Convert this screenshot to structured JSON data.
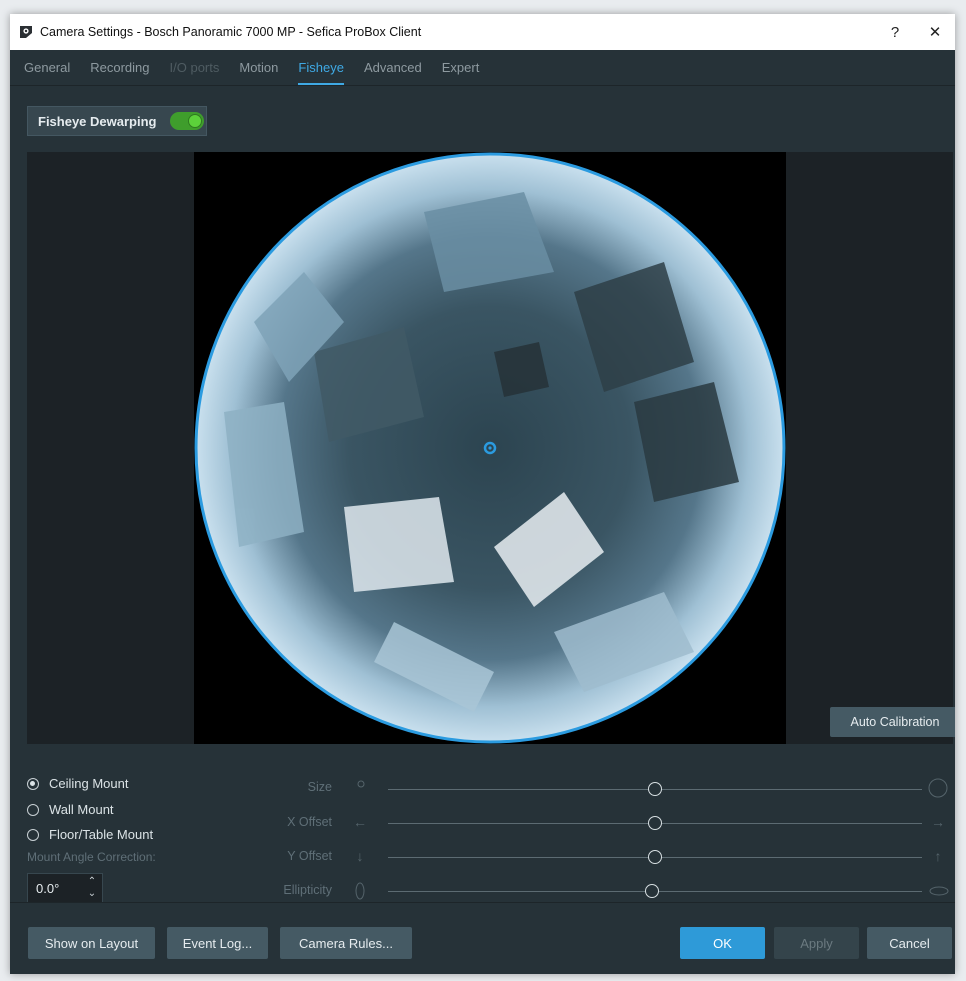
{
  "window": {
    "title": "Camera Settings - Bosch Panoramic 7000 MP - Sefica ProBox Client",
    "help_label": "?",
    "close_label": "✕"
  },
  "tabs": [
    {
      "label": "General",
      "state": "normal"
    },
    {
      "label": "Recording",
      "state": "normal"
    },
    {
      "label": "I/O ports",
      "state": "disabled"
    },
    {
      "label": "Motion",
      "state": "normal"
    },
    {
      "label": "Fisheye",
      "state": "active"
    },
    {
      "label": "Advanced",
      "state": "normal"
    },
    {
      "label": "Expert",
      "state": "normal"
    }
  ],
  "fisheye": {
    "dewarping_label": "Fisheye Dewarping",
    "dewarping_enabled": true,
    "auto_calibration_label": "Auto Calibration"
  },
  "mount": {
    "options": [
      {
        "label": "Ceiling Mount",
        "checked": true
      },
      {
        "label": "Wall Mount",
        "checked": false
      },
      {
        "label": "Floor/Table Mount",
        "checked": false
      }
    ],
    "angle_label": "Mount Angle Correction:",
    "angle_value": "0.0°"
  },
  "sliders": [
    {
      "label": "Size",
      "value": 0.5
    },
    {
      "label": "X Offset",
      "value": 0.5
    },
    {
      "label": "Y Offset",
      "value": 0.5
    },
    {
      "label": "Ellipticity",
      "value": 0.495
    }
  ],
  "footer": {
    "show_on_layout": "Show on Layout",
    "event_log": "Event Log...",
    "camera_rules": "Camera Rules...",
    "ok": "OK",
    "apply": "Apply",
    "cancel": "Cancel"
  },
  "colors": {
    "accent": "#3fa9e4",
    "window_bg": "#263238",
    "toggle_on": "#3f9d2c",
    "ok_button": "#2e9ad8"
  }
}
